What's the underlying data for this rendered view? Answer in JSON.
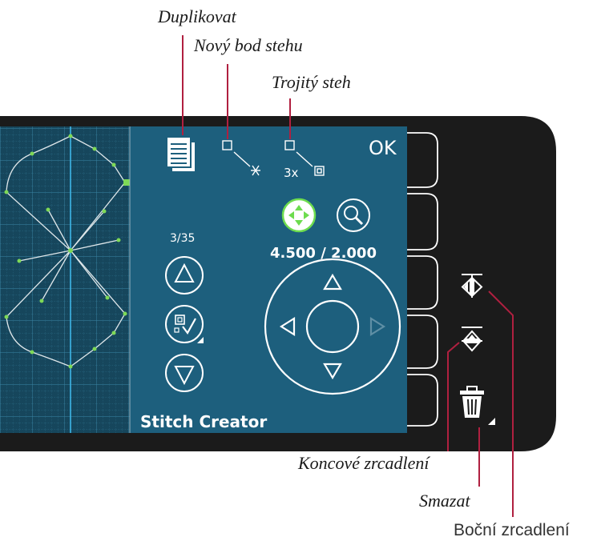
{
  "callouts": {
    "duplicate": "Duplikovat",
    "new_stitch_point": "Nový bod stehu",
    "triple_stitch": "Trojitý steh",
    "end_mirror": "Koncové zrcadlení",
    "delete": "Smazat",
    "side_mirror": "Boční zrcadlení"
  },
  "screen": {
    "ok_label": "OK",
    "triple_label": "3x",
    "stitch_counter": "3/35",
    "coordinates": "4.500 / 2.000",
    "app_title": "Stitch Creator"
  },
  "icons": {
    "duplicate": "document-copy-icon",
    "new_point": "new-point-icon",
    "triple": "triple-stitch-icon",
    "move": "move-arrows-icon",
    "zoom": "magnifier-icon",
    "up": "triangle-up-icon",
    "select": "select-point-icon",
    "down": "triangle-down-icon",
    "side_mirror": "mirror-side-icon",
    "end_mirror": "mirror-end-icon",
    "delete": "trash-icon"
  },
  "colors": {
    "screen_bg": "#1d5f7d",
    "grid_bg": "#16465c",
    "machine_body": "#1b1b1b",
    "leader_line": "#b02040",
    "stitch_point": "#7ed957",
    "guide_line": "#3fb6e8",
    "active_move": "#6ddc4e"
  }
}
